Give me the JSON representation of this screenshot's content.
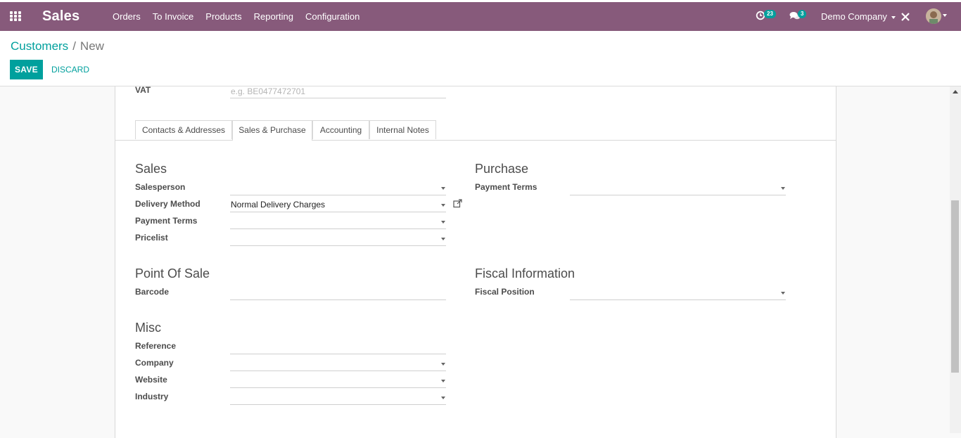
{
  "navbar": {
    "app_name": "Sales",
    "menu": [
      "Orders",
      "To Invoice",
      "Products",
      "Reporting",
      "Configuration"
    ],
    "activity_count": "23",
    "messages_count": "3",
    "company": "Demo Company",
    "background": "#875a7b"
  },
  "breadcrumb": {
    "parent": "Customers",
    "separator": "/",
    "current": "New"
  },
  "actions": {
    "save_label": "SAVE",
    "discard_label": "DISCARD"
  },
  "form": {
    "vat_label": "VAT",
    "vat_placeholder": "e.g. BE0477472701",
    "tabs": [
      {
        "label": "Contacts & Addresses",
        "active": false
      },
      {
        "label": "Sales & Purchase",
        "active": true
      },
      {
        "label": "Accounting",
        "active": false
      },
      {
        "label": "Internal Notes",
        "active": false
      }
    ],
    "sales": {
      "title": "Sales",
      "salesperson_label": "Salesperson",
      "salesperson_value": "",
      "delivery_method_label": "Delivery Method",
      "delivery_method_value": "Normal Delivery Charges",
      "payment_terms_label": "Payment Terms",
      "payment_terms_value": "",
      "pricelist_label": "Pricelist",
      "pricelist_value": ""
    },
    "purchase": {
      "title": "Purchase",
      "payment_terms_label": "Payment Terms",
      "payment_terms_value": ""
    },
    "pos": {
      "title": "Point Of Sale",
      "barcode_label": "Barcode",
      "barcode_value": ""
    },
    "fiscal": {
      "title": "Fiscal Information",
      "fiscal_position_label": "Fiscal Position",
      "fiscal_position_value": ""
    },
    "misc": {
      "title": "Misc",
      "reference_label": "Reference",
      "reference_value": "",
      "company_label": "Company",
      "company_value": "",
      "website_label": "Website",
      "website_value": "",
      "industry_label": "Industry",
      "industry_value": ""
    }
  },
  "colors": {
    "primary": "#00a09d",
    "navbar": "#875a7b"
  }
}
